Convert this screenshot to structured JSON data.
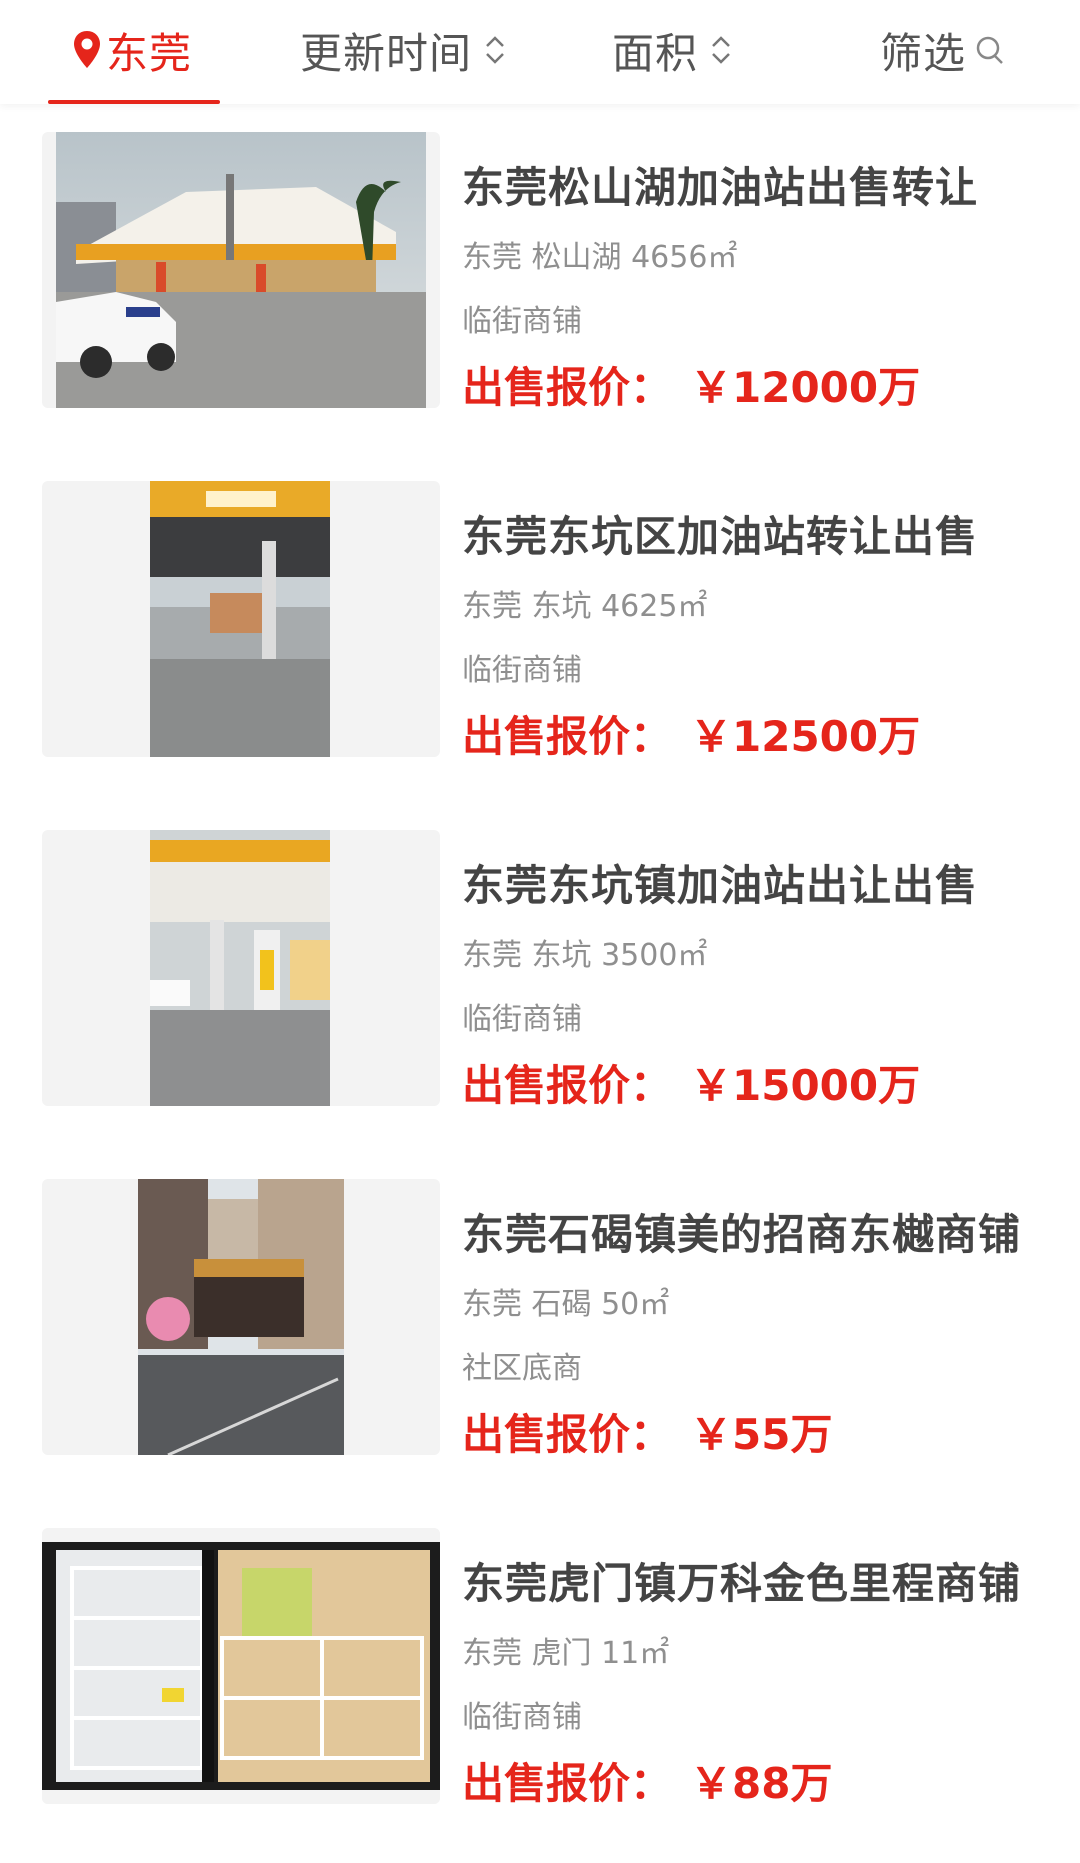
{
  "header": {
    "city": "东莞",
    "sort_time": "更新时间",
    "sort_area": "面积",
    "filter": "筛选"
  },
  "colors": {
    "accent": "#e5251b",
    "title": "#444444",
    "meta": "#8f8f8f"
  },
  "listings": [
    {
      "title": "东莞松山湖加油站出售转让",
      "meta": "东莞 松山湖 4656㎡",
      "tag": "临街商铺",
      "price_label": "出售报价：",
      "price": "￥12000万"
    },
    {
      "title": "东莞东坑区加油站转让出售",
      "meta": "东莞 东坑 4625㎡",
      "tag": "临街商铺",
      "price_label": "出售报价：",
      "price": "￥12500万"
    },
    {
      "title": "东莞东坑镇加油站出让出售",
      "meta": "东莞 东坑 3500㎡",
      "tag": "临街商铺",
      "price_label": "出售报价：",
      "price": "￥15000万"
    },
    {
      "title": "东莞石碣镇美的招商东樾商铺",
      "meta": "东莞 石碣 50㎡",
      "tag": "社区底商",
      "price_label": "出售报价：",
      "price": "￥55万"
    },
    {
      "title": "东莞虎门镇万科金色里程商铺",
      "meta": "东莞 虎门 11㎡",
      "tag": "临街商铺",
      "price_label": "出售报价：",
      "price": "￥88万"
    }
  ]
}
